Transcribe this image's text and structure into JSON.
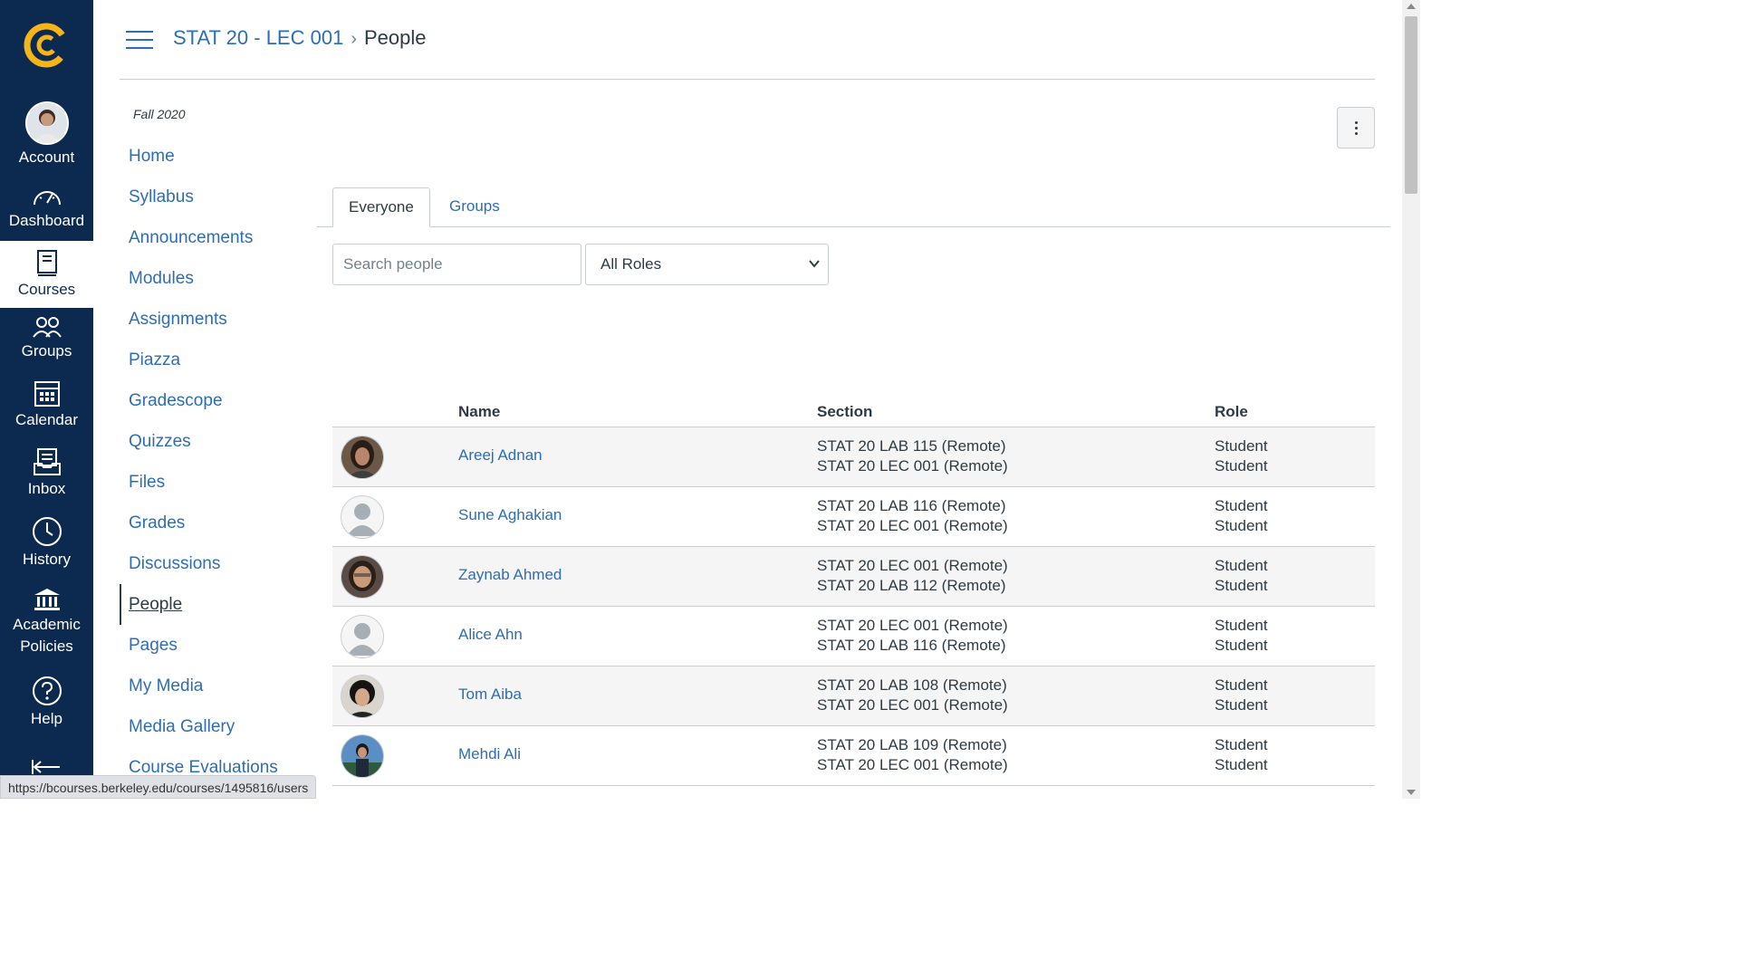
{
  "global_nav": {
    "items": [
      {
        "label": "Account",
        "icon": "user-avatar"
      },
      {
        "label": "Dashboard",
        "icon": "dashboard-icon"
      },
      {
        "label": "Courses",
        "icon": "courses-icon"
      },
      {
        "label": "Groups",
        "icon": "groups-icon"
      },
      {
        "label": "Calendar",
        "icon": "calendar-icon"
      },
      {
        "label": "Inbox",
        "icon": "inbox-icon"
      },
      {
        "label": "History",
        "icon": "history-icon"
      },
      {
        "label": "Academic",
        "label2": "Policies",
        "icon": "academic-policies-icon"
      },
      {
        "label": "Help",
        "icon": "help-icon"
      }
    ],
    "brand_color": "#0c2a4f",
    "logo_color": "#f5b519"
  },
  "header": {
    "course": "STAT 20 - LEC 001",
    "separator": "›",
    "current": "People"
  },
  "course_nav": {
    "term": "Fall 2020",
    "items": [
      "Home",
      "Syllabus",
      "Announcements",
      "Modules",
      "Assignments",
      "Piazza",
      "Gradescope",
      "Quizzes",
      "Files",
      "Grades",
      "Discussions",
      "People",
      "Pages",
      "My Media",
      "Media Gallery",
      "Course Evaluations"
    ],
    "active": "People"
  },
  "tabs": [
    "Everyone",
    "Groups"
  ],
  "filters": {
    "search_placeholder": "Search people",
    "role_selected": "All Roles"
  },
  "table": {
    "headers": [
      "Name",
      "Section",
      "Role"
    ],
    "rows": [
      {
        "name": "Areej Adnan",
        "sections": [
          "STAT 20 LAB 115 (Remote)",
          "STAT 20 LEC 001 (Remote)"
        ],
        "roles": [
          "Student",
          "Student"
        ],
        "avatar": "photo"
      },
      {
        "name": "Sune Aghakian",
        "sections": [
          "STAT 20 LAB 116 (Remote)",
          "STAT 20 LEC 001 (Remote)"
        ],
        "roles": [
          "Student",
          "Student"
        ],
        "avatar": "default"
      },
      {
        "name": "Zaynab Ahmed",
        "sections": [
          "STAT 20 LEC 001 (Remote)",
          "STAT 20 LAB 112 (Remote)"
        ],
        "roles": [
          "Student",
          "Student"
        ],
        "avatar": "photo"
      },
      {
        "name": "Alice Ahn",
        "sections": [
          "STAT 20 LEC 001 (Remote)",
          "STAT 20 LAB 116 (Remote)"
        ],
        "roles": [
          "Student",
          "Student"
        ],
        "avatar": "default"
      },
      {
        "name": "Tom Aiba",
        "sections": [
          "STAT 20 LAB 108 (Remote)",
          "STAT 20 LEC 001 (Remote)"
        ],
        "roles": [
          "Student",
          "Student"
        ],
        "avatar": "photo"
      },
      {
        "name": "Mehdi Ali",
        "sections": [
          "STAT 20 LAB 109 (Remote)",
          "STAT 20 LEC 001 (Remote)"
        ],
        "roles": [
          "Student",
          "Student"
        ],
        "avatar": "photo"
      }
    ]
  },
  "status_url": "https://bcourses.berkeley.edu/courses/1495816/users",
  "colors": {
    "link": "#2d6db5",
    "text": "#2d3b45",
    "border": "#c7cdd1",
    "stripe": "#f5f5f5"
  }
}
